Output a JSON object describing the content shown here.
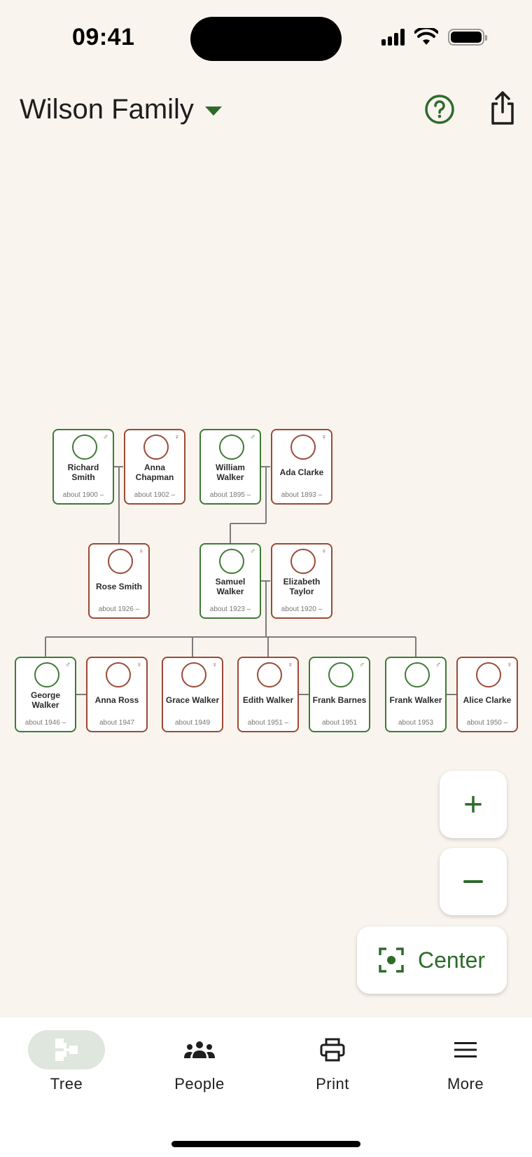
{
  "status_bar": {
    "time": "09:41"
  },
  "header": {
    "title": "Wilson Family"
  },
  "tree": {
    "people": [
      {
        "id": "richard",
        "name": "Richard Smith",
        "dates": "about 1900 –",
        "sex": "male"
      },
      {
        "id": "anna-c",
        "name": "Anna Chapman",
        "dates": "about 1902 –",
        "sex": "female"
      },
      {
        "id": "william",
        "name": "William Walker",
        "dates": "about 1895 –",
        "sex": "male"
      },
      {
        "id": "ada",
        "name": "Ada Clarke",
        "dates": "about 1893 –",
        "sex": "female"
      },
      {
        "id": "rose",
        "name": "Rose Smith",
        "dates": "about 1926 –",
        "sex": "female"
      },
      {
        "id": "samuel",
        "name": "Samuel Walker",
        "dates": "about 1923 –",
        "sex": "male"
      },
      {
        "id": "elizabeth",
        "name": "Elizabeth Taylor",
        "dates": "about 1920 –",
        "sex": "female"
      },
      {
        "id": "george",
        "name": "George Walker",
        "dates": "about 1946 –",
        "sex": "male"
      },
      {
        "id": "anna-r",
        "name": "Anna Ross",
        "dates": "about 1947",
        "sex": "female"
      },
      {
        "id": "grace",
        "name": "Grace Walker",
        "dates": "about 1949",
        "sex": "female"
      },
      {
        "id": "edith",
        "name": "Edith Walker",
        "dates": "about 1951 –",
        "sex": "female"
      },
      {
        "id": "frank-b",
        "name": "Frank Barnes",
        "dates": "about 1951",
        "sex": "male"
      },
      {
        "id": "frank-w",
        "name": "Frank Walker",
        "dates": "about 1953",
        "sex": "male"
      },
      {
        "id": "alice",
        "name": "Alice Clarke",
        "dates": "about 1950 –",
        "sex": "female"
      }
    ]
  },
  "controls": {
    "zoom_in": "+",
    "center_label": "Center"
  },
  "bottom_nav": [
    {
      "label": "Tree",
      "icon": "tree-icon",
      "active": true
    },
    {
      "label": "People",
      "icon": "people-icon",
      "active": false
    },
    {
      "label": "Print",
      "icon": "print-icon",
      "active": false
    },
    {
      "label": "More",
      "icon": "menu-icon",
      "active": false
    }
  ],
  "colors": {
    "accent": "#2e6b2a",
    "male": "#3f7a35",
    "female": "#9b4a37",
    "background": "#f9f4ee"
  }
}
